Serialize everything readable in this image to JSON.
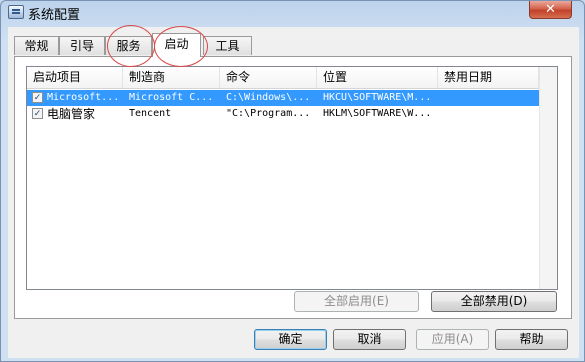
{
  "window": {
    "title": "系统配置",
    "close_label": "✕"
  },
  "tabs": [
    {
      "label": "常规",
      "active": false
    },
    {
      "label": "引导",
      "active": false
    },
    {
      "label": "服务",
      "active": false
    },
    {
      "label": "启动",
      "active": true
    },
    {
      "label": "工具",
      "active": false
    }
  ],
  "startup_list": {
    "columns": [
      "启动项目",
      "制造商",
      "命令",
      "位置",
      "禁用日期"
    ],
    "rows": [
      {
        "checked": true,
        "selected": true,
        "item": "Microsoft...",
        "manufacturer": "Microsoft C...",
        "command": "C:\\Windows\\...",
        "location": "HKCU\\SOFTWARE\\M...",
        "disabled_date": ""
      },
      {
        "checked": true,
        "selected": false,
        "item": "电脑管家",
        "manufacturer": "Tencent",
        "command": "\"C:\\Program...",
        "location": "HKLM\\SOFTWARE\\W...",
        "disabled_date": ""
      }
    ]
  },
  "panel_buttons": {
    "enable_all": "全部启用(E)",
    "disable_all": "全部禁用(D)"
  },
  "dialog_buttons": {
    "ok": "确定",
    "cancel": "取消",
    "apply": "应用(A)",
    "help": "帮助"
  },
  "checkmark": "✓"
}
